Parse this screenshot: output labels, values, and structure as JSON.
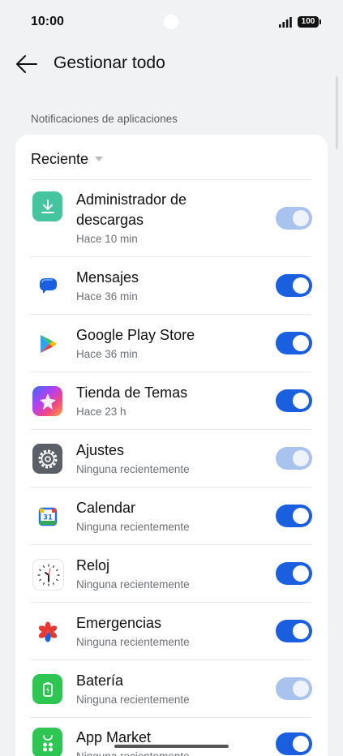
{
  "status": {
    "time": "10:00",
    "battery": "100",
    "signal_icon": "signal-icon",
    "battery_icon": "battery-icon"
  },
  "header": {
    "title": "Gestionar todo",
    "back_icon": "arrow-left-icon"
  },
  "section": {
    "label": "Notificaciones de aplicaciones"
  },
  "sort": {
    "label": "Reciente",
    "icon": "caret-down-icon"
  },
  "colors": {
    "toggle_on": "#1a5fe0",
    "toggle_disabled": "#a9c3ef",
    "background": "#f1f2f4"
  },
  "apps": [
    {
      "name_line1": "Administrador de",
      "name_line2": "descargas",
      "sub": "Hace 10 min",
      "icon": "download-icon",
      "toggle": "on-disabled"
    },
    {
      "name_line1": "Mensajes",
      "sub": "Hace 36 min",
      "icon": "messages-icon",
      "toggle": "on"
    },
    {
      "name_line1": "Google Play Store",
      "sub": "Hace 36 min",
      "icon": "play-store-icon",
      "toggle": "on"
    },
    {
      "name_line1": "Tienda de Temas",
      "sub": "Hace 23 h",
      "icon": "theme-store-icon",
      "toggle": "on"
    },
    {
      "name_line1": "Ajustes",
      "sub": "Ninguna recientemente",
      "icon": "settings-gear-icon",
      "toggle": "on-disabled"
    },
    {
      "name_line1": "Calendar",
      "sub": "Ninguna recientemente",
      "icon": "calendar-icon",
      "icon_text": "31",
      "toggle": "on"
    },
    {
      "name_line1": "Reloj",
      "sub": "Ninguna recientemente",
      "icon": "clock-icon",
      "toggle": "on"
    },
    {
      "name_line1": "Emergencias",
      "sub": "Ninguna recientemente",
      "icon": "emergency-icon",
      "toggle": "on"
    },
    {
      "name_line1": "Batería",
      "sub": "Ninguna recientemente",
      "icon": "battery-app-icon",
      "toggle": "on-disabled"
    },
    {
      "name_line1": "App Market",
      "sub": "Ninguna recientemente",
      "icon": "app-market-icon",
      "toggle": "on"
    }
  ]
}
